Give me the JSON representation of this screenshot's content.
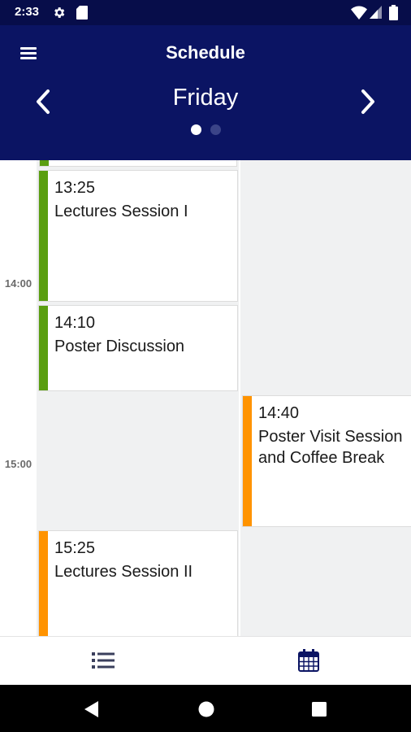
{
  "status_bar": {
    "time": "2:33"
  },
  "header": {
    "title": "Schedule",
    "day": "Friday"
  },
  "time_labels": [
    "14:00",
    "15:00"
  ],
  "events": [
    {
      "time": "13:25",
      "title": "Lectures Session I",
      "color": "#5a9e10"
    },
    {
      "time": "14:10",
      "title": "Poster Discussion",
      "color": "#5a9e10"
    },
    {
      "time": "14:40",
      "title_line1": "Poster Visit Session",
      "title_line2": "and Coffee Break",
      "color": "#ff9300"
    },
    {
      "time": "15:25",
      "title": "Lectures Session II",
      "color": "#ff9300"
    }
  ],
  "colors": {
    "app_bar": "#0b1463",
    "status_bar": "#070d4a",
    "column_bg": "#f0f1f2"
  },
  "icons": [
    "menu-icon",
    "chevron-left-icon",
    "chevron-right-icon",
    "list-icon",
    "calendar-icon",
    "back-icon",
    "home-icon",
    "recents-icon"
  ]
}
